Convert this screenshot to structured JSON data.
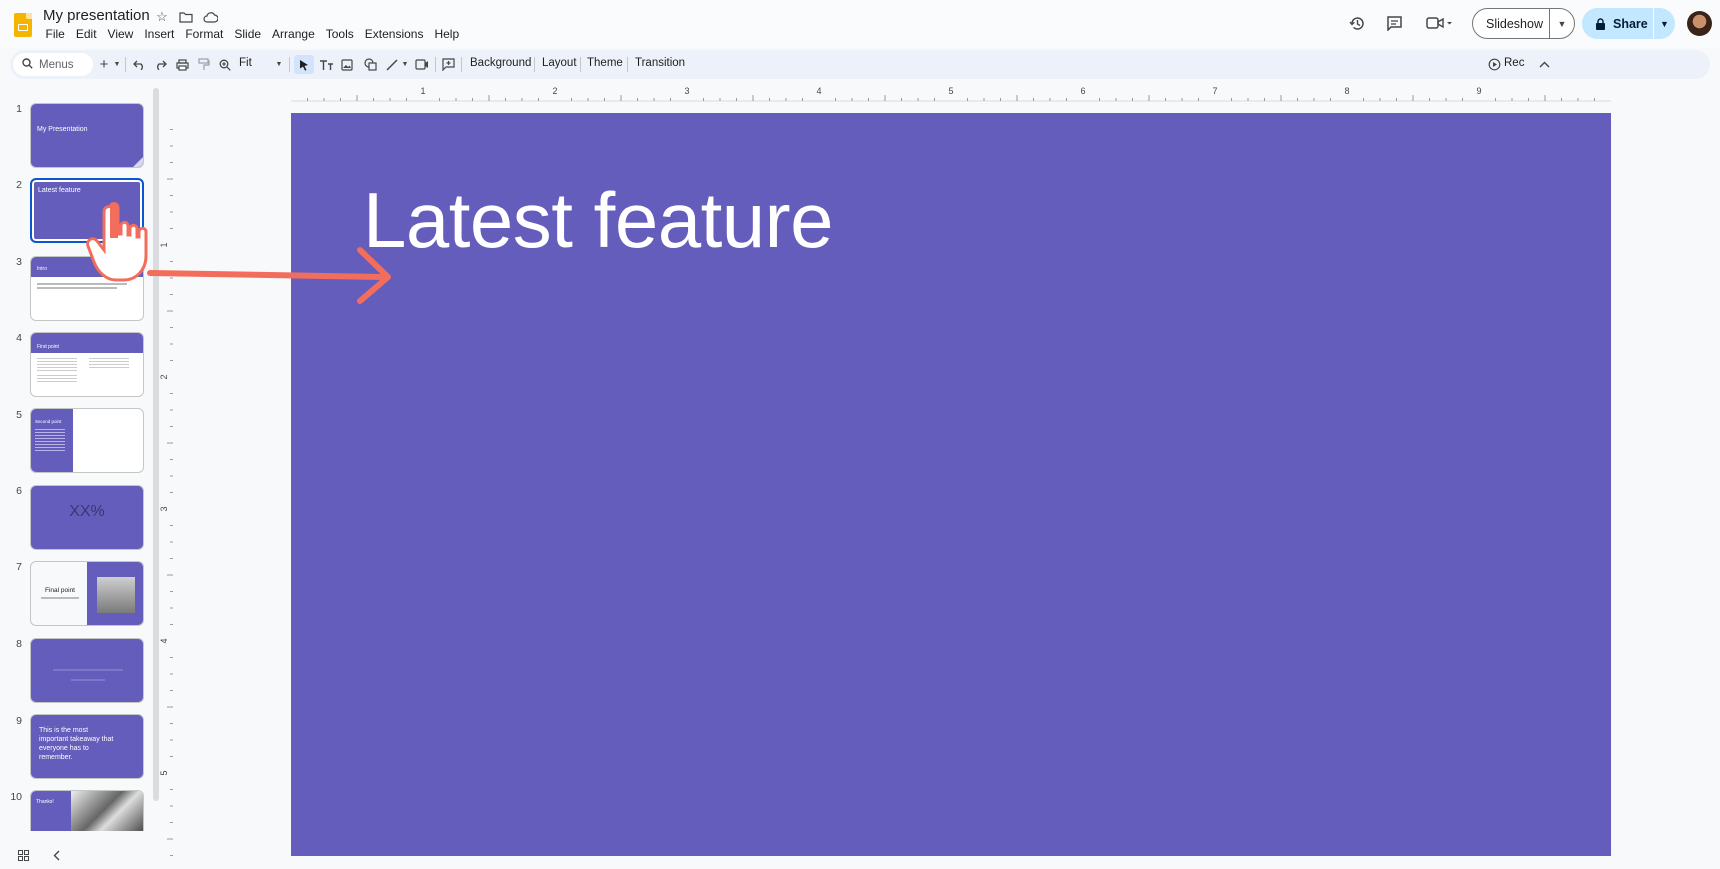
{
  "app": {
    "doc_title": "My presentation",
    "menu": [
      "File",
      "Edit",
      "View",
      "Insert",
      "Format",
      "Slide",
      "Arrange",
      "Tools",
      "Extensions",
      "Help"
    ],
    "slideshow_label": "Slideshow",
    "share_label": "Share"
  },
  "toolbar": {
    "search_label": "Menus",
    "zoom_label": "Fit",
    "background_label": "Background",
    "layout_label": "Layout",
    "theme_label": "Theme",
    "transition_label": "Transition",
    "rec_label": "Rec"
  },
  "ruler": {
    "h_labels": [
      "1",
      "2",
      "3",
      "4",
      "5",
      "6",
      "7",
      "8",
      "9"
    ],
    "v_labels": [
      "1",
      "2",
      "3",
      "4",
      "5"
    ]
  },
  "slides": [
    {
      "num": "1",
      "title": "My Presentation"
    },
    {
      "num": "2",
      "title": "Latest feature",
      "selected": true
    },
    {
      "num": "3",
      "title": "Intro"
    },
    {
      "num": "4",
      "title": "First point"
    },
    {
      "num": "5",
      "title": "Second point"
    },
    {
      "num": "6",
      "title": "XX%"
    },
    {
      "num": "7",
      "title": "Final point"
    },
    {
      "num": "8",
      "title": ""
    },
    {
      "num": "9",
      "title": "This is the most important takeaway that everyone has to remember."
    },
    {
      "num": "10",
      "title": "Thanks!"
    }
  ],
  "current_slide": {
    "title": "Latest feature"
  },
  "colors": {
    "slide_purple": "#655dbb",
    "accent_blue": "#0b57d0",
    "share_bg": "#c2e7ff",
    "pointer_arrow": "#f26d5b"
  },
  "icons": {
    "cursor": "hand-pointer-icon",
    "annotation": "arrow-right-icon"
  }
}
